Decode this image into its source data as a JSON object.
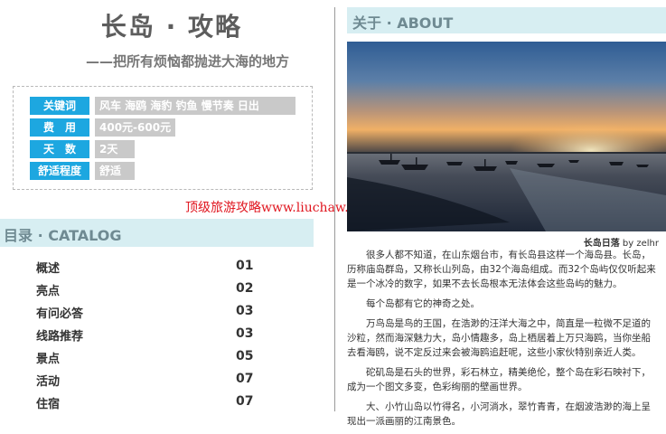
{
  "left": {
    "title": "长岛 · 攻略",
    "subtitle": "——把所有烦恼都抛进大海的地方",
    "info": [
      {
        "label": "关键词",
        "value": "风车 海鸥 海豹 钓鱼 慢节奏 日出"
      },
      {
        "label": "费　用",
        "value": "400元-600元"
      },
      {
        "label": "天　数",
        "value": "2天"
      },
      {
        "label": "舒适程度",
        "value": "舒适"
      }
    ],
    "watermark": "顶级旅游攻略www.liuchaw.com/lvyou/allvyou",
    "catalog": {
      "title": "目录 · CATALOG",
      "items": [
        {
          "name": "概述",
          "page": "01"
        },
        {
          "name": "亮点",
          "page": "02"
        },
        {
          "name": "有问必答",
          "page": "03"
        },
        {
          "name": "线路推荐",
          "page": "03"
        },
        {
          "name": "景点",
          "page": "05"
        },
        {
          "name": "活动",
          "page": "07"
        },
        {
          "name": "住宿",
          "page": "07"
        }
      ]
    }
  },
  "right": {
    "about_title": "关于 · ABOUT",
    "caption_title": "长岛日落",
    "caption_author": "by zelhr",
    "paragraphs": [
      "很多人都不知道，在山东烟台市，有长岛县这样一个海岛县。长岛，历称庙岛群岛，又称长山列岛，由32个海岛组成。而32个岛屿仅仅听起来是一个冰冷的数字，如果不去长岛根本无法体会这些岛屿的魅力。",
      "每个岛都有它的神奇之处。",
      "万鸟岛是鸟的王国，在浩渺的汪洋大海之中，简直是一粒微不足道的沙粒，然而海深魅力大，岛小情趣多，岛上栖居着上万只海鸥，当你坐船去看海鸥，说不定反过来会被海鸥追赶呢，这些小家伙特别亲近人类。",
      "砣矶岛是石头的世界，彩石林立，精美绝伦，整个岛在彩石映衬下，成为一个图文多变，色彩绚丽的壁画世界。",
      "大、小竹山岛以竹得名，小河淌水，翠竹青青，在烟波浩渺的海上呈现出一派画丽的江南景色。"
    ]
  }
}
